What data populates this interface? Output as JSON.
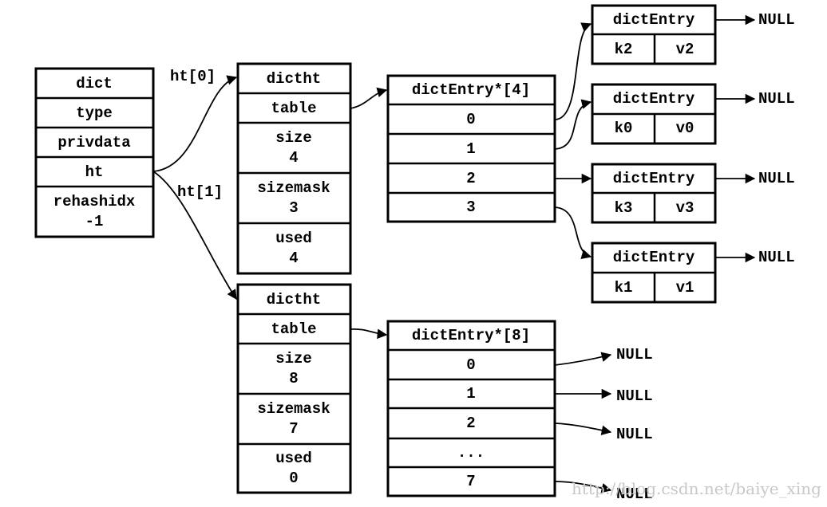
{
  "dict": {
    "rows": [
      "dict",
      "type",
      "privdata",
      "ht"
    ],
    "rehashidx_label": "rehashidx",
    "rehashidx_value": "-1"
  },
  "pointers": {
    "ht0": "ht[0]",
    "ht1": "ht[1]"
  },
  "dictht0": {
    "title": "dictht",
    "table": "table",
    "size_label": "size",
    "size": "4",
    "sizemask_label": "sizemask",
    "sizemask": "3",
    "used_label": "used",
    "used": "4"
  },
  "dictht1": {
    "title": "dictht",
    "table": "table",
    "size_label": "size",
    "size": "8",
    "sizemask_label": "sizemask",
    "sizemask": "7",
    "used_label": "used",
    "used": "0"
  },
  "array4": {
    "title": "dictEntry*[4]",
    "slots": [
      "0",
      "1",
      "2",
      "3"
    ]
  },
  "array8": {
    "title": "dictEntry*[8]",
    "slots": [
      "0",
      "1",
      "2",
      "...",
      "7"
    ]
  },
  "entries": [
    {
      "title": "dictEntry",
      "key": "k2",
      "value": "v2",
      "next": "NULL"
    },
    {
      "title": "dictEntry",
      "key": "k0",
      "value": "v0",
      "next": "NULL"
    },
    {
      "title": "dictEntry",
      "key": "k3",
      "value": "v3",
      "next": "NULL"
    },
    {
      "title": "dictEntry",
      "key": "k1",
      "value": "v1",
      "next": "NULL"
    }
  ],
  "array8_nulls": [
    "NULL",
    "NULL",
    "NULL",
    "NULL"
  ],
  "watermark": "http://blog.csdn.net/baiye_xing"
}
